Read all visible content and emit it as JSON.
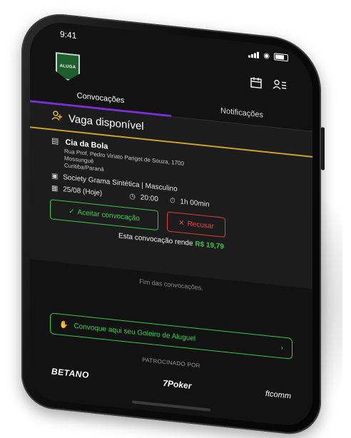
{
  "status_bar": {
    "time": "9:41"
  },
  "logo": {
    "text": "ALUGA"
  },
  "header": {
    "calendar_icon": "calendar-icon",
    "profile_icon": "profile-menu-icon"
  },
  "tabs": [
    {
      "label": "Convocações",
      "active": true
    },
    {
      "label": "Notificações",
      "active": false
    }
  ],
  "card": {
    "title": "Vaga disponível",
    "title_icon": "user-plus-icon",
    "venue_name": "Cia da Bola",
    "address_line1": "Rua Prof. Pedro Viriato Parigot de Souza, 1700",
    "address_line2": "Mossunguê",
    "address_line3": "Curitiba/Paraná",
    "field_type": "Society Grama Sintética | Masculino",
    "date": "25/08 (Hoje)",
    "time": "20:00",
    "duration": "1h 00min",
    "accept_label": "Aceitar convocação",
    "refuse_label": "Recusar",
    "earnings_prefix": "Esta convocação rende",
    "earnings_value": "R$ 19,79"
  },
  "list_end": "Fim das convocações.",
  "cta_label": "Convoque aqui seu Goleiro de Aluguel",
  "sponsors": {
    "label": "PATROCINADO POR",
    "items": [
      "BETANO",
      "7Poker",
      "ftcomm"
    ]
  },
  "colors": {
    "accent_green": "#36c94a",
    "accent_red": "#e23a3a",
    "accent_gold": "#c9a32a",
    "accent_purple": "#7a2fd0"
  }
}
